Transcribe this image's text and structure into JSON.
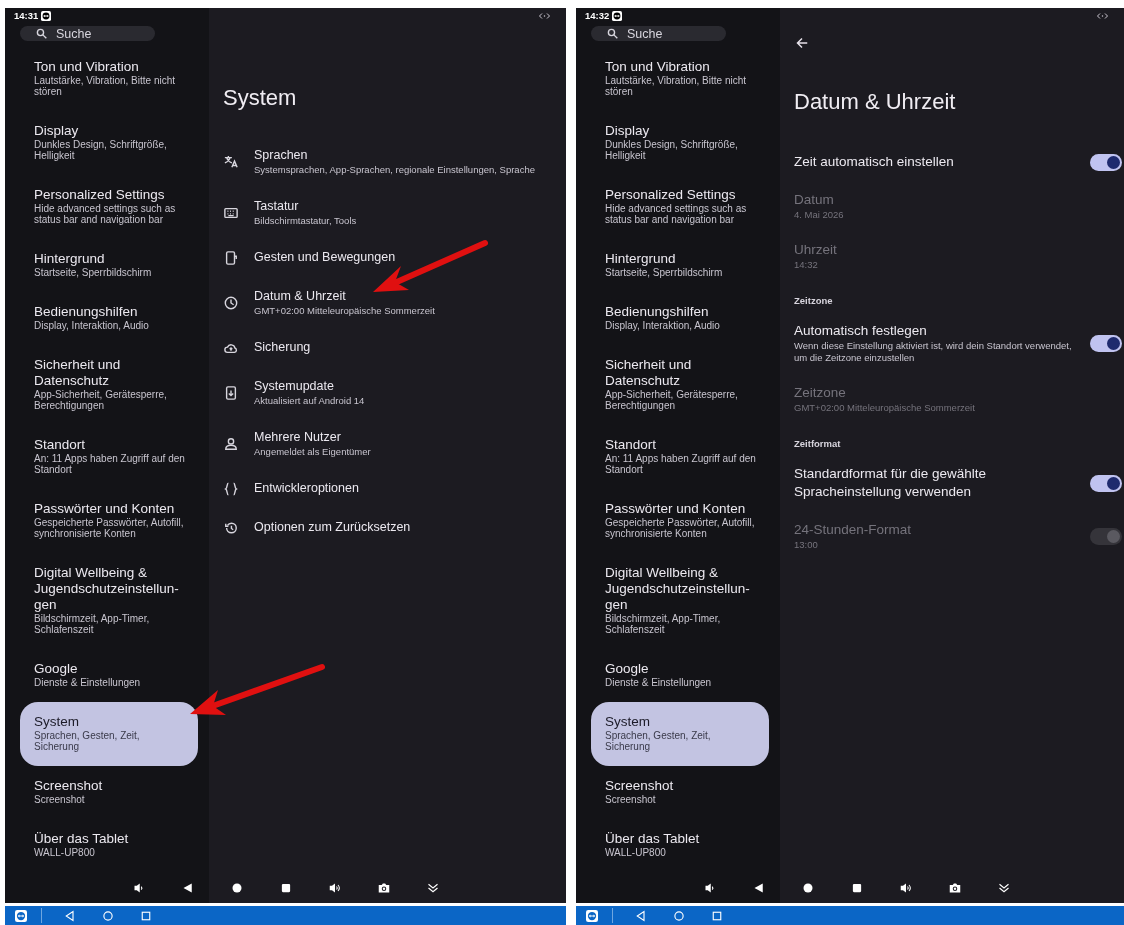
{
  "panels": [
    {
      "status_bar": {
        "time": "14:31"
      },
      "sidebar": {
        "search": {
          "placeholder": "Suche"
        },
        "items": [
          {
            "title": "Ton und Vibration",
            "summary": "Lautstärke, Vibration, Bitte nicht stören",
            "selected": false
          },
          {
            "title": "Display",
            "summary": "Dunkles Design, Schriftgröße, Helligkeit",
            "selected": false
          },
          {
            "title": "Personalized Settings",
            "summary": "Hide advanced settings such as status bar and navigation bar",
            "selected": false
          },
          {
            "title": "Hintergrund",
            "summary": "Startseite, Sperrbildschirm",
            "selected": false
          },
          {
            "title": "Bedienungshilfen",
            "summary": "Display, Interaktion, Audio",
            "selected": false
          },
          {
            "title": "Sicherheit und Datenschutz",
            "summary": "App-Sicherheit, Gerätesperre, Berechtigungen",
            "selected": false
          },
          {
            "title": "Standort",
            "summary": "An: 11 Apps haben Zugriff auf den Standort",
            "selected": false
          },
          {
            "title": "Passwörter und Konten",
            "summary": "Gespeicherte Passwörter, Autofill, synchronisierte Konten",
            "selected": false
          },
          {
            "title": "Digital Wellbeing & Jugendschutzeinstellun-gen",
            "summary": "Bildschirmzeit, App-Timer, Schlafenszeit",
            "selected": false
          },
          {
            "title": "Google",
            "summary": "Dienste & Einstellungen",
            "selected": false
          },
          {
            "title": "System",
            "summary": "Sprachen, Gesten, Zeit, Sicherung",
            "selected": true
          },
          {
            "title": "Screenshot",
            "summary": "Screenshot",
            "selected": false
          },
          {
            "title": "Über das Tablet",
            "summary": "WALL-UP800",
            "selected": false
          }
        ]
      },
      "detail": {
        "kind": "list",
        "back_button": false,
        "title": "System",
        "items": [
          {
            "title": "Sprachen",
            "summary": "Systemsprachen, App-Sprachen, regionale Einstellungen, Sprache"
          },
          {
            "title": "Tastatur",
            "summary": "Bildschirmtastatur, Tools"
          },
          {
            "title": "Gesten und Bewegungen"
          },
          {
            "title": "Datum & Uhrzeit",
            "summary": "GMT+02:00 Mitteleuropäische Sommerzeit"
          },
          {
            "title": "Sicherung"
          },
          {
            "title": "Systemupdate",
            "summary": "Aktualisiert auf Android 14"
          },
          {
            "title": "Mehrere Nutzer",
            "summary": "Angemeldet als Eigentümer"
          },
          {
            "title": "Entwickleroptionen"
          },
          {
            "title": "Optionen zum Zurücksetzen"
          }
        ]
      }
    },
    {
      "status_bar": {
        "time": "14:32"
      },
      "sidebar": {
        "search": {
          "placeholder": "Suche"
        },
        "items": [
          {
            "title": "Ton und Vibration",
            "summary": "Lautstärke, Vibration, Bitte nicht stören",
            "selected": false
          },
          {
            "title": "Display",
            "summary": "Dunkles Design, Schriftgröße, Helligkeit",
            "selected": false
          },
          {
            "title": "Personalized Settings",
            "summary": "Hide advanced settings such as status bar and navigation bar",
            "selected": false
          },
          {
            "title": "Hintergrund",
            "summary": "Startseite, Sperrbildschirm",
            "selected": false
          },
          {
            "title": "Bedienungshilfen",
            "summary": "Display, Interaktion, Audio",
            "selected": false
          },
          {
            "title": "Sicherheit und Datenschutz",
            "summary": "App-Sicherheit, Gerätesperre, Berechtigungen",
            "selected": false
          },
          {
            "title": "Standort",
            "summary": "An: 11 Apps haben Zugriff auf den Standort",
            "selected": false
          },
          {
            "title": "Passwörter und Konten",
            "summary": "Gespeicherte Passwörter, Autofill, synchronisierte Konten",
            "selected": false
          },
          {
            "title": "Digital Wellbeing & Jugendschutzeinstellun-gen",
            "summary": "Bildschirmzeit, App-Timer, Schlafenszeit",
            "selected": false
          },
          {
            "title": "Google",
            "summary": "Dienste & Einstellungen",
            "selected": false
          },
          {
            "title": "System",
            "summary": "Sprachen, Gesten, Zeit, Sicherung",
            "selected": true
          },
          {
            "title": "Screenshot",
            "summary": "Screenshot",
            "selected": false
          },
          {
            "title": "Über das Tablet",
            "summary": "WALL-UP800",
            "selected": false
          }
        ]
      },
      "detail": {
        "kind": "settings",
        "back_button": true,
        "title": "Datum & Uhrzeit",
        "rows": [
          {
            "kind": "switch",
            "title": "Zeit automatisch einstellen",
            "on": true,
            "disabled": false
          },
          {
            "kind": "item",
            "title": "Datum",
            "summary": "4. Mai 2026",
            "disabled": true
          },
          {
            "kind": "item",
            "title": "Uhrzeit",
            "summary": "14:32",
            "disabled": true
          },
          {
            "kind": "header",
            "title": "Zeitzone"
          },
          {
            "kind": "switch",
            "title": "Automatisch festlegen",
            "summary": "Wenn diese Einstellung aktiviert ist, wird dein Standort verwendet, um die Zeitzone einzustellen",
            "on": true,
            "disabled": false
          },
          {
            "kind": "item",
            "title": "Zeitzone",
            "summary": "GMT+02:00 Mitteleuropäische Sommerzeit",
            "disabled": true
          },
          {
            "kind": "header",
            "title": "Zeitformat"
          },
          {
            "kind": "switch",
            "title": "Standardformat für die gewählte Spracheinstellung verwenden",
            "on": true,
            "disabled": false
          },
          {
            "kind": "switch",
            "title": "24-Stunden-Format",
            "summary": "13:00",
            "on": true,
            "disabled": true
          }
        ]
      }
    }
  ]
}
